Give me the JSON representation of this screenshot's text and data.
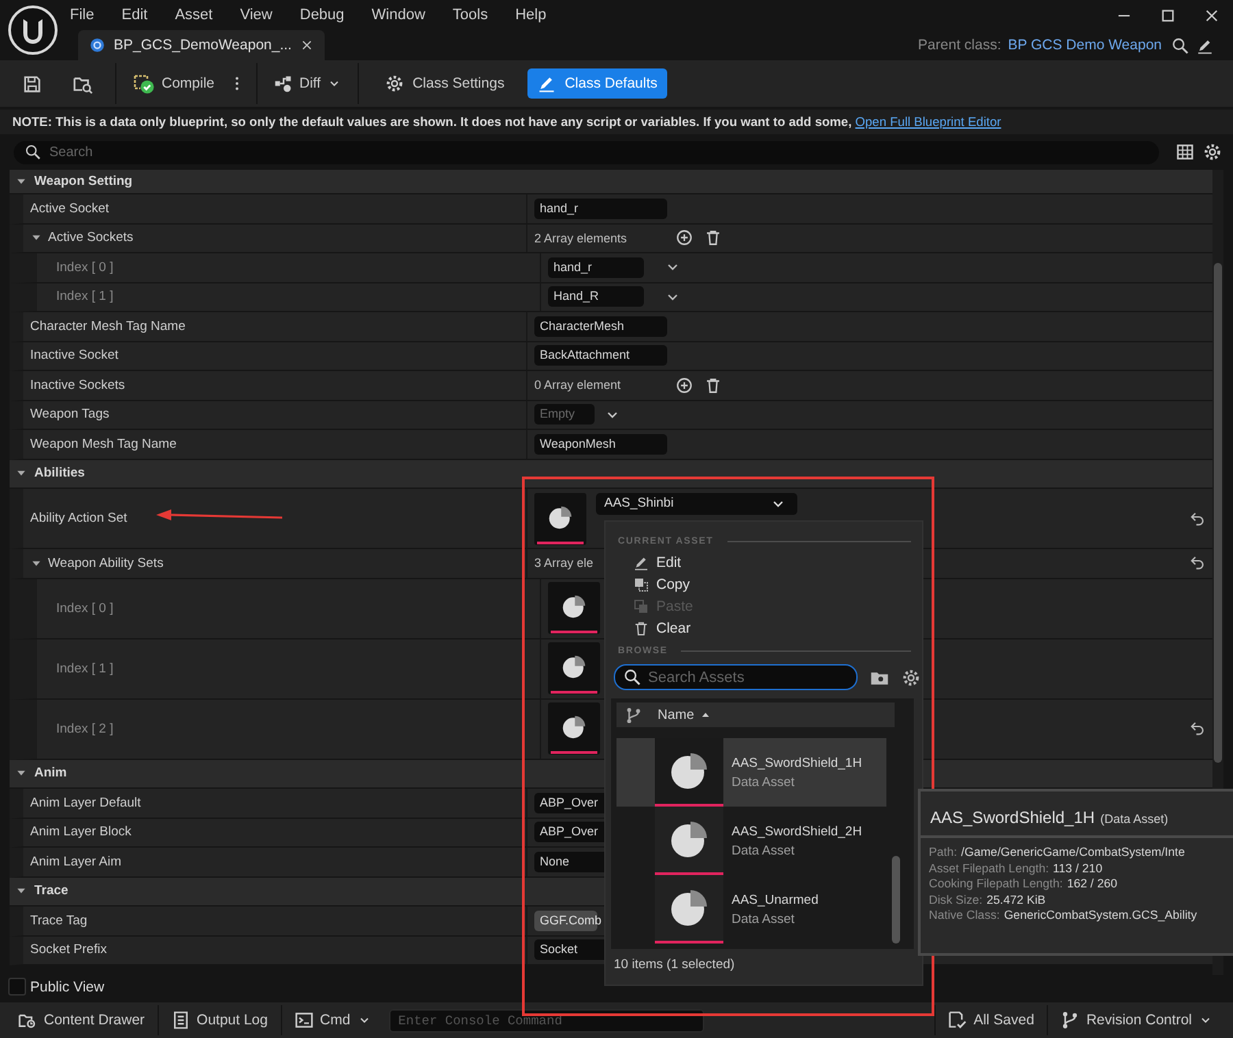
{
  "menu": [
    "File",
    "Edit",
    "Asset",
    "View",
    "Debug",
    "Window",
    "Tools",
    "Help"
  ],
  "document_tab": {
    "label": "BP_GCS_DemoWeapon_..."
  },
  "parent_class": {
    "label": "Parent class:",
    "value": "BP GCS Demo Weapon"
  },
  "toolbar": {
    "compile": "Compile",
    "diff": "Diff",
    "modes": [
      {
        "label": "Class Settings",
        "selected": false
      },
      {
        "label": "Class Defaults",
        "selected": true
      }
    ]
  },
  "note": {
    "text": "NOTE: This is a data only blueprint, so only the default values are shown.  It does not have any script or variables.  If you want to add some,",
    "link": "Open Full Blueprint Editor"
  },
  "search": {
    "placeholder": "Search"
  },
  "categories": [
    {
      "name": "Weapon Setting",
      "expanded": true,
      "properties": [
        {
          "kind": "text",
          "label": "Active Socket",
          "value": "hand_r"
        },
        {
          "kind": "array",
          "label": "Active Sockets",
          "value": "2 Array elements",
          "expanded": true,
          "children": [
            {
              "kind": "combo",
              "label": "Index [ 0 ]",
              "value": "hand_r"
            },
            {
              "kind": "combo",
              "label": "Index [ 1 ]",
              "value": "Hand_R"
            }
          ]
        },
        {
          "kind": "text",
          "label": "Character Mesh Tag Name",
          "value": "CharacterMesh"
        },
        {
          "kind": "text",
          "label": "Inactive Socket",
          "value": "BackAttachment"
        },
        {
          "kind": "array",
          "label": "Inactive Sockets",
          "value": "0 Array element"
        },
        {
          "kind": "tags",
          "label": "Weapon Tags",
          "placeholder": "Empty"
        },
        {
          "kind": "text",
          "label": "Weapon Mesh Tag Name",
          "value": "WeaponMesh"
        }
      ]
    },
    {
      "name": "Abilities",
      "expanded": true,
      "properties": [
        {
          "kind": "asset",
          "label": "Ability Action Set",
          "value": "AAS_Shinbi",
          "reset": true
        },
        {
          "kind": "array",
          "label": "Weapon Ability Sets",
          "value": "3 Array ele",
          "expanded": true,
          "reset": true,
          "children": [
            {
              "kind": "asset",
              "label": "Index [ 0 ]"
            },
            {
              "kind": "asset",
              "label": "Index [ 1 ]"
            },
            {
              "kind": "asset",
              "label": "Index [ 2 ]",
              "reset": true
            }
          ]
        }
      ]
    },
    {
      "name": "Anim",
      "expanded": true,
      "properties": [
        {
          "kind": "text",
          "label": "Anim Layer Default",
          "value": "ABP_Over"
        },
        {
          "kind": "text",
          "label": "Anim Layer Block",
          "value": "ABP_Over"
        },
        {
          "kind": "text",
          "label": "Anim Layer Aim",
          "value": "None"
        }
      ]
    },
    {
      "name": "Trace",
      "expanded": true,
      "properties": [
        {
          "kind": "tag",
          "label": "Trace Tag",
          "value": "GGF.Comb"
        },
        {
          "kind": "text",
          "label": "Socket Prefix",
          "value": "Socket"
        }
      ]
    }
  ],
  "public_view": {
    "label": "Public View",
    "checked": false
  },
  "asset_picker": {
    "current_section": "CURRENT ASSET",
    "actions": [
      {
        "label": "Edit",
        "disabled": false
      },
      {
        "label": "Copy",
        "disabled": false
      },
      {
        "label": "Paste",
        "disabled": true
      },
      {
        "label": "Clear",
        "disabled": false
      }
    ],
    "browse_section": "BROWSE",
    "search": {
      "placeholder": "Search Assets"
    },
    "column": "Name",
    "assets": [
      {
        "name": "AAS_SwordShield_1H",
        "type": "Data Asset",
        "highlighted": true
      },
      {
        "name": "AAS_SwordShield_2H",
        "type": "Data Asset",
        "highlighted": false
      },
      {
        "name": "AAS_Unarmed",
        "type": "Data Asset",
        "highlighted": false
      }
    ],
    "status": "10 items (1 selected)"
  },
  "tooltip": {
    "title": "AAS_SwordShield_1H",
    "subtitle": "(Data Asset)",
    "details": [
      {
        "label": "Path:",
        "value": "/Game/GenericGame/CombatSystem/Inte"
      },
      {
        "label": "Asset Filepath Length:",
        "value": "113 / 210"
      },
      {
        "label": "Cooking Filepath Length:",
        "value": "162 / 260"
      },
      {
        "label": "Disk Size:",
        "value": "25.472 KiB"
      },
      {
        "label": "Native Class:",
        "value": "GenericCombatSystem.GCS_Ability"
      }
    ]
  },
  "bottom_bar": {
    "content_drawer": "Content Drawer",
    "output_log": "Output Log",
    "cmd": "Cmd",
    "console": {
      "placeholder": "Enter Console Command"
    },
    "saved": "All Saved",
    "revision": "Revision Control"
  }
}
